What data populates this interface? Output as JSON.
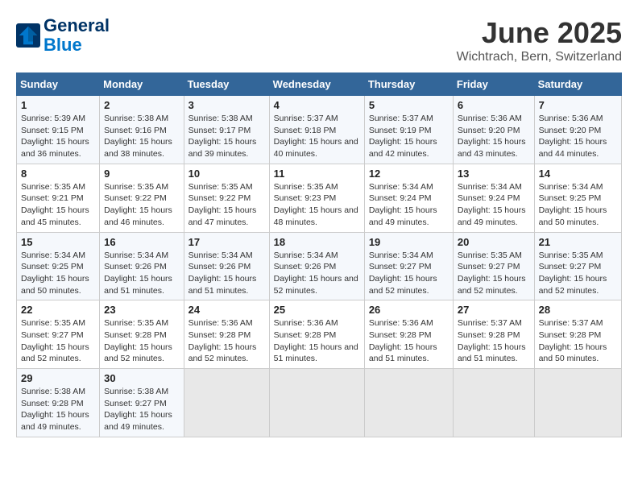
{
  "header": {
    "logo_line1": "General",
    "logo_line2": "Blue",
    "title": "June 2025",
    "subtitle": "Wichtrach, Bern, Switzerland"
  },
  "columns": [
    "Sunday",
    "Monday",
    "Tuesday",
    "Wednesday",
    "Thursday",
    "Friday",
    "Saturday"
  ],
  "rows": [
    [
      {
        "day": "1",
        "sunrise": "Sunrise: 5:39 AM",
        "sunset": "Sunset: 9:15 PM",
        "daylight": "Daylight: 15 hours and 36 minutes."
      },
      {
        "day": "2",
        "sunrise": "Sunrise: 5:38 AM",
        "sunset": "Sunset: 9:16 PM",
        "daylight": "Daylight: 15 hours and 38 minutes."
      },
      {
        "day": "3",
        "sunrise": "Sunrise: 5:38 AM",
        "sunset": "Sunset: 9:17 PM",
        "daylight": "Daylight: 15 hours and 39 minutes."
      },
      {
        "day": "4",
        "sunrise": "Sunrise: 5:37 AM",
        "sunset": "Sunset: 9:18 PM",
        "daylight": "Daylight: 15 hours and 40 minutes."
      },
      {
        "day": "5",
        "sunrise": "Sunrise: 5:37 AM",
        "sunset": "Sunset: 9:19 PM",
        "daylight": "Daylight: 15 hours and 42 minutes."
      },
      {
        "day": "6",
        "sunrise": "Sunrise: 5:36 AM",
        "sunset": "Sunset: 9:20 PM",
        "daylight": "Daylight: 15 hours and 43 minutes."
      },
      {
        "day": "7",
        "sunrise": "Sunrise: 5:36 AM",
        "sunset": "Sunset: 9:20 PM",
        "daylight": "Daylight: 15 hours and 44 minutes."
      }
    ],
    [
      {
        "day": "8",
        "sunrise": "Sunrise: 5:35 AM",
        "sunset": "Sunset: 9:21 PM",
        "daylight": "Daylight: 15 hours and 45 minutes."
      },
      {
        "day": "9",
        "sunrise": "Sunrise: 5:35 AM",
        "sunset": "Sunset: 9:22 PM",
        "daylight": "Daylight: 15 hours and 46 minutes."
      },
      {
        "day": "10",
        "sunrise": "Sunrise: 5:35 AM",
        "sunset": "Sunset: 9:22 PM",
        "daylight": "Daylight: 15 hours and 47 minutes."
      },
      {
        "day": "11",
        "sunrise": "Sunrise: 5:35 AM",
        "sunset": "Sunset: 9:23 PM",
        "daylight": "Daylight: 15 hours and 48 minutes."
      },
      {
        "day": "12",
        "sunrise": "Sunrise: 5:34 AM",
        "sunset": "Sunset: 9:24 PM",
        "daylight": "Daylight: 15 hours and 49 minutes."
      },
      {
        "day": "13",
        "sunrise": "Sunrise: 5:34 AM",
        "sunset": "Sunset: 9:24 PM",
        "daylight": "Daylight: 15 hours and 49 minutes."
      },
      {
        "day": "14",
        "sunrise": "Sunrise: 5:34 AM",
        "sunset": "Sunset: 9:25 PM",
        "daylight": "Daylight: 15 hours and 50 minutes."
      }
    ],
    [
      {
        "day": "15",
        "sunrise": "Sunrise: 5:34 AM",
        "sunset": "Sunset: 9:25 PM",
        "daylight": "Daylight: 15 hours and 50 minutes."
      },
      {
        "day": "16",
        "sunrise": "Sunrise: 5:34 AM",
        "sunset": "Sunset: 9:26 PM",
        "daylight": "Daylight: 15 hours and 51 minutes."
      },
      {
        "day": "17",
        "sunrise": "Sunrise: 5:34 AM",
        "sunset": "Sunset: 9:26 PM",
        "daylight": "Daylight: 15 hours and 51 minutes."
      },
      {
        "day": "18",
        "sunrise": "Sunrise: 5:34 AM",
        "sunset": "Sunset: 9:26 PM",
        "daylight": "Daylight: 15 hours and 52 minutes."
      },
      {
        "day": "19",
        "sunrise": "Sunrise: 5:34 AM",
        "sunset": "Sunset: 9:27 PM",
        "daylight": "Daylight: 15 hours and 52 minutes."
      },
      {
        "day": "20",
        "sunrise": "Sunrise: 5:35 AM",
        "sunset": "Sunset: 9:27 PM",
        "daylight": "Daylight: 15 hours and 52 minutes."
      },
      {
        "day": "21",
        "sunrise": "Sunrise: 5:35 AM",
        "sunset": "Sunset: 9:27 PM",
        "daylight": "Daylight: 15 hours and 52 minutes."
      }
    ],
    [
      {
        "day": "22",
        "sunrise": "Sunrise: 5:35 AM",
        "sunset": "Sunset: 9:27 PM",
        "daylight": "Daylight: 15 hours and 52 minutes."
      },
      {
        "day": "23",
        "sunrise": "Sunrise: 5:35 AM",
        "sunset": "Sunset: 9:28 PM",
        "daylight": "Daylight: 15 hours and 52 minutes."
      },
      {
        "day": "24",
        "sunrise": "Sunrise: 5:36 AM",
        "sunset": "Sunset: 9:28 PM",
        "daylight": "Daylight: 15 hours and 52 minutes."
      },
      {
        "day": "25",
        "sunrise": "Sunrise: 5:36 AM",
        "sunset": "Sunset: 9:28 PM",
        "daylight": "Daylight: 15 hours and 51 minutes."
      },
      {
        "day": "26",
        "sunrise": "Sunrise: 5:36 AM",
        "sunset": "Sunset: 9:28 PM",
        "daylight": "Daylight: 15 hours and 51 minutes."
      },
      {
        "day": "27",
        "sunrise": "Sunrise: 5:37 AM",
        "sunset": "Sunset: 9:28 PM",
        "daylight": "Daylight: 15 hours and 51 minutes."
      },
      {
        "day": "28",
        "sunrise": "Sunrise: 5:37 AM",
        "sunset": "Sunset: 9:28 PM",
        "daylight": "Daylight: 15 hours and 50 minutes."
      }
    ],
    [
      {
        "day": "29",
        "sunrise": "Sunrise: 5:38 AM",
        "sunset": "Sunset: 9:28 PM",
        "daylight": "Daylight: 15 hours and 49 minutes."
      },
      {
        "day": "30",
        "sunrise": "Sunrise: 5:38 AM",
        "sunset": "Sunset: 9:27 PM",
        "daylight": "Daylight: 15 hours and 49 minutes."
      },
      null,
      null,
      null,
      null,
      null
    ]
  ]
}
